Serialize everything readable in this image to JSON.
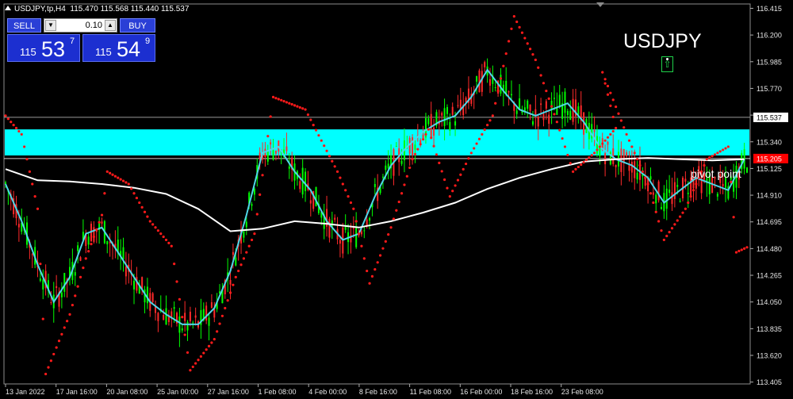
{
  "header": {
    "symbol_timeframe": "USDJPY,tp,H4",
    "open": "115.470",
    "high": "115.568",
    "low": "115.440",
    "close": "115.537"
  },
  "trade_panel": {
    "sell_label": "SELL",
    "buy_label": "BUY",
    "lot": "0.10",
    "lot_down_icon": "triangle-down",
    "lot_up_icon": "triangle-up",
    "sell_price_small": "115",
    "sell_price_big": "53",
    "sell_price_sup": "7",
    "buy_price_small": "115",
    "buy_price_big": "54",
    "buy_price_sup": "9"
  },
  "labels": {
    "symbol": "USDJPY",
    "pivot": "pivot point"
  },
  "colors": {
    "background": "#000000",
    "bull_candle": "#00ff00",
    "bear_candle": "#ff2a2a",
    "zone": "#00ffff",
    "fast_ma": "#4fd6e8",
    "slow_ma": "#ffffff",
    "sar": "#ff1a1a",
    "current_price_tag": "#ffffff",
    "pivot_price_tag": "#ff0000",
    "panel_button": "#2a3fd6"
  },
  "chart_data": {
    "type": "candlestick",
    "y_axis": {
      "ylim": [
        113.39,
        116.45
      ],
      "ticks": [
        "116.415",
        "116.200",
        "115.985",
        "115.770",
        "115.555",
        "115.340",
        "115.125",
        "114.910",
        "114.695",
        "114.480",
        "114.265",
        "114.050",
        "113.835",
        "113.620",
        "113.405"
      ]
    },
    "x_axis": {
      "labels": [
        "13 Jan 2022",
        "17 Jan 16:00",
        "20 Jan 08:00",
        "25 Jan 00:00",
        "27 Jan 16:00",
        "1 Feb 08:00",
        "4 Feb 00:00",
        "8 Feb 16:00",
        "11 Feb 08:00",
        "16 Feb 00:00",
        "18 Feb 16:00",
        "23 Feb 08:00"
      ]
    },
    "current_price": "115.537",
    "pivot_price": "115.205",
    "resistance_zone": [
      115.23,
      115.44
    ],
    "moving_averages": [
      {
        "id": "fast",
        "points": [
          [
            0,
            115.0
          ],
          [
            6,
            114.7
          ],
          [
            12,
            114.35
          ],
          [
            18,
            114.05
          ],
          [
            24,
            114.25
          ],
          [
            30,
            114.6
          ],
          [
            36,
            114.65
          ],
          [
            42,
            114.45
          ],
          [
            48,
            114.25
          ],
          [
            54,
            114.05
          ],
          [
            60,
            113.95
          ],
          [
            66,
            113.87
          ],
          [
            72,
            113.87
          ],
          [
            78,
            114.0
          ],
          [
            84,
            114.3
          ],
          [
            90,
            114.75
          ],
          [
            96,
            115.25
          ],
          [
            102,
            115.3
          ],
          [
            108,
            115.1
          ],
          [
            114,
            114.95
          ],
          [
            120,
            114.7
          ],
          [
            126,
            114.55
          ],
          [
            132,
            114.6
          ],
          [
            138,
            114.9
          ],
          [
            144,
            115.15
          ],
          [
            150,
            115.3
          ],
          [
            156,
            115.42
          ],
          [
            162,
            115.5
          ],
          [
            168,
            115.55
          ],
          [
            174,
            115.7
          ],
          [
            180,
            115.92
          ],
          [
            186,
            115.75
          ],
          [
            192,
            115.6
          ],
          [
            198,
            115.55
          ],
          [
            204,
            115.6
          ],
          [
            210,
            115.65
          ],
          [
            216,
            115.5
          ],
          [
            222,
            115.3
          ],
          [
            228,
            115.2
          ],
          [
            234,
            115.15
          ],
          [
            240,
            115.05
          ],
          [
            246,
            114.85
          ],
          [
            252,
            114.95
          ],
          [
            258,
            115.05
          ],
          [
            264,
            115.0
          ],
          [
            270,
            114.95
          ],
          [
            276,
            115.2
          ]
        ]
      },
      {
        "id": "slow",
        "points": [
          [
            0,
            115.12
          ],
          [
            12,
            115.03
          ],
          [
            24,
            115.02
          ],
          [
            36,
            115.0
          ],
          [
            48,
            114.97
          ],
          [
            60,
            114.92
          ],
          [
            72,
            114.8
          ],
          [
            84,
            114.62
          ],
          [
            96,
            114.64
          ],
          [
            108,
            114.7
          ],
          [
            120,
            114.68
          ],
          [
            132,
            114.65
          ],
          [
            144,
            114.7
          ],
          [
            156,
            114.77
          ],
          [
            168,
            114.85
          ],
          [
            180,
            114.96
          ],
          [
            192,
            115.05
          ],
          [
            204,
            115.12
          ],
          [
            216,
            115.18
          ],
          [
            228,
            115.2
          ],
          [
            240,
            115.21
          ],
          [
            252,
            115.2
          ],
          [
            264,
            115.19
          ],
          [
            276,
            115.2
          ]
        ]
      }
    ],
    "sar_segments": [
      {
        "points": [
          [
            0,
            115.55
          ],
          [
            6,
            115.4
          ],
          [
            12,
            114.8
          ],
          [
            15,
            113.47
          ],
          [
            24,
            113.95
          ],
          [
            30,
            114.4
          ],
          [
            36,
            114.75
          ],
          [
            38,
            115.1
          ],
          [
            46,
            115.0
          ],
          [
            54,
            114.7
          ],
          [
            62,
            114.5
          ],
          [
            69,
            113.5
          ],
          [
            78,
            113.75
          ],
          [
            86,
            114.25
          ],
          [
            93,
            114.6
          ],
          [
            100,
            115.7
          ],
          [
            112,
            115.6
          ],
          [
            124,
            115.1
          ],
          [
            130,
            114.8
          ],
          [
            136,
            114.2
          ],
          [
            144,
            114.65
          ],
          [
            152,
            115.2
          ],
          [
            158,
            115.44
          ],
          [
            166,
            114.9
          ],
          [
            174,
            115.25
          ],
          [
            182,
            115.55
          ],
          [
            190,
            116.35
          ],
          [
            198,
            116.0
          ],
          [
            206,
            115.5
          ],
          [
            212,
            115.1
          ],
          [
            220,
            115.25
          ],
          [
            228,
            115.45
          ],
          [
            223,
            115.9
          ],
          [
            232,
            115.4
          ],
          [
            240,
            115.0
          ],
          [
            246,
            114.55
          ],
          [
            254,
            114.8
          ],
          [
            262,
            115.2
          ],
          [
            270,
            115.3
          ],
          [
            273,
            114.45
          ],
          [
            278,
            114.5
          ]
        ]
      }
    ]
  }
}
